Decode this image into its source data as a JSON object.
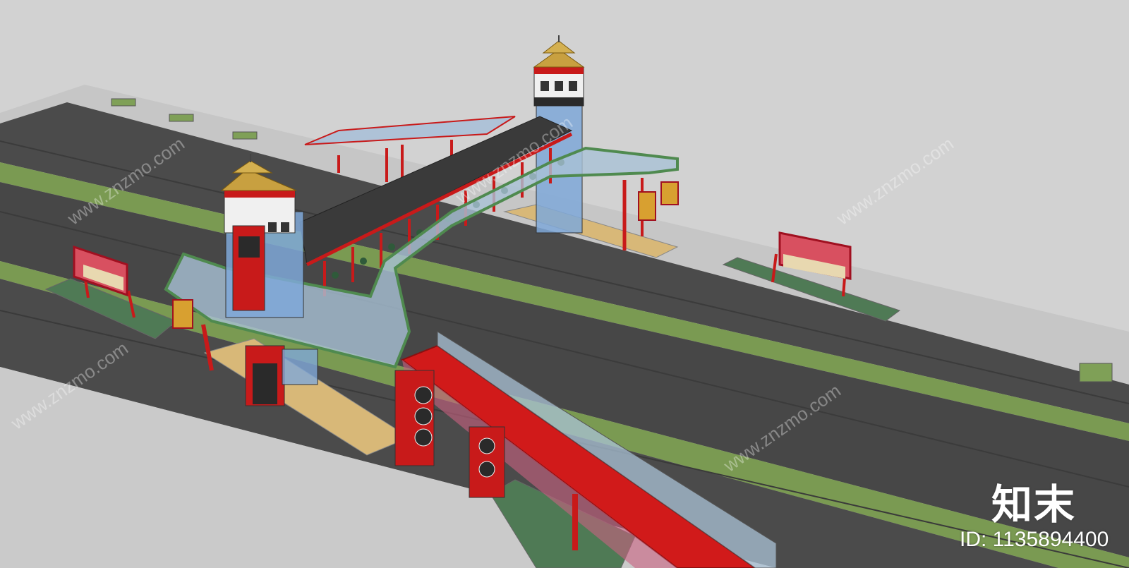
{
  "scene": {
    "description_kind": "3d-rendered-model",
    "colors": {
      "ground": "#cfcfcf",
      "sidewalk": "#c4c4c4",
      "road": "#4a4a4a",
      "median_green": "#7b9a55",
      "bridge_red": "#c81a1a",
      "roof_dark": "#3a3a3a",
      "glass": "#8fb7d8",
      "gold": "#c8a040",
      "paving": "#d8b878"
    }
  },
  "watermark": {
    "logo_text": "知末",
    "id_text": "ID: 1135894400",
    "diagonal_text": "www.znzmo.com"
  }
}
